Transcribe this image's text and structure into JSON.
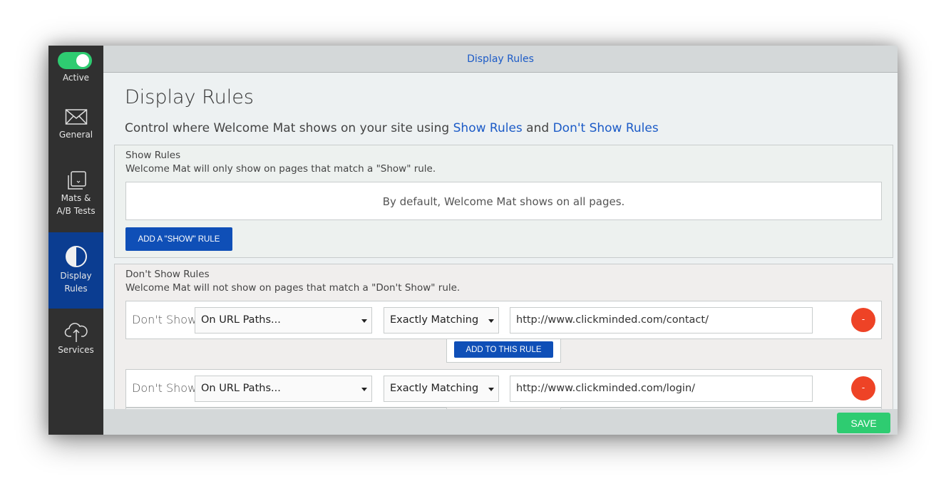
{
  "header": {
    "title": "Display Rules"
  },
  "sidebar": {
    "toggle": {
      "label": "Active",
      "state": "on",
      "color": "#2ecc71"
    },
    "items": [
      {
        "id": "general",
        "label": "General",
        "icon": "envelope-icon",
        "active": false
      },
      {
        "id": "mats",
        "label_line1": "Mats &",
        "label_line2": "A/B Tests",
        "icon": "stacked-layers-icon",
        "active": false
      },
      {
        "id": "display",
        "label_line1": "Display",
        "label_line2": "Rules",
        "icon": "half-circle-icon",
        "active": true
      },
      {
        "id": "services",
        "label": "Services",
        "icon": "cloud-upload-icon",
        "active": false
      }
    ]
  },
  "page": {
    "title": "Display Rules",
    "subtitle_prefix": "Control where Welcome Mat shows on your site using ",
    "subtitle_link1": "Show Rules",
    "subtitle_and": " and ",
    "subtitle_link2": "Don't Show Rules"
  },
  "show_rules": {
    "title": "Show Rules",
    "description": "Welcome Mat will only show on pages that match a \"Show\" rule.",
    "default_text": "By default, Welcome Mat shows on all pages.",
    "add_button": "ADD A \"SHOW\" RULE"
  },
  "dont_show_rules": {
    "title": "Don't Show Rules",
    "description": "Welcome Mat will not show on pages that match a \"Don't Show\" rule.",
    "add_to_rule_button": "ADD TO THIS RULE",
    "rules": [
      {
        "label": "Don't Show",
        "type": "On URL Paths...",
        "match": "Exactly Matching",
        "url": "http://www.clickminded.com/contact/",
        "remove": "-"
      },
      {
        "label": "Don't Show",
        "type": "On URL Paths...",
        "match": "Exactly Matching",
        "url": "http://www.clickminded.com/login/",
        "remove": "-"
      }
    ]
  },
  "footer": {
    "save_label": "SAVE"
  },
  "colors": {
    "accent_blue": "#0f4fb7",
    "link_blue": "#1c5bc7",
    "save_green": "#2ecc71",
    "remove_red": "#ee4326",
    "sidebar_bg": "#303030",
    "sidebar_active": "#0b3d91"
  }
}
